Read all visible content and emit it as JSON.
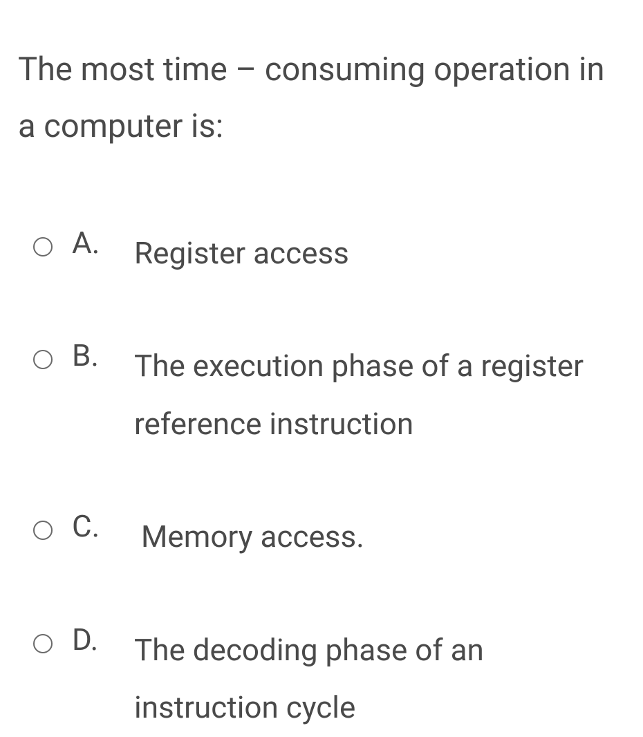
{
  "question": "The most time – consuming operation in a computer is:",
  "options": [
    {
      "letter": "A.",
      "text": "Register access"
    },
    {
      "letter": "B.",
      "text": "The execution phase of a register reference instruction"
    },
    {
      "letter": "C.",
      "text": " Memory access."
    },
    {
      "letter": "D.",
      "text": "The decoding phase of an instruction cycle"
    }
  ]
}
